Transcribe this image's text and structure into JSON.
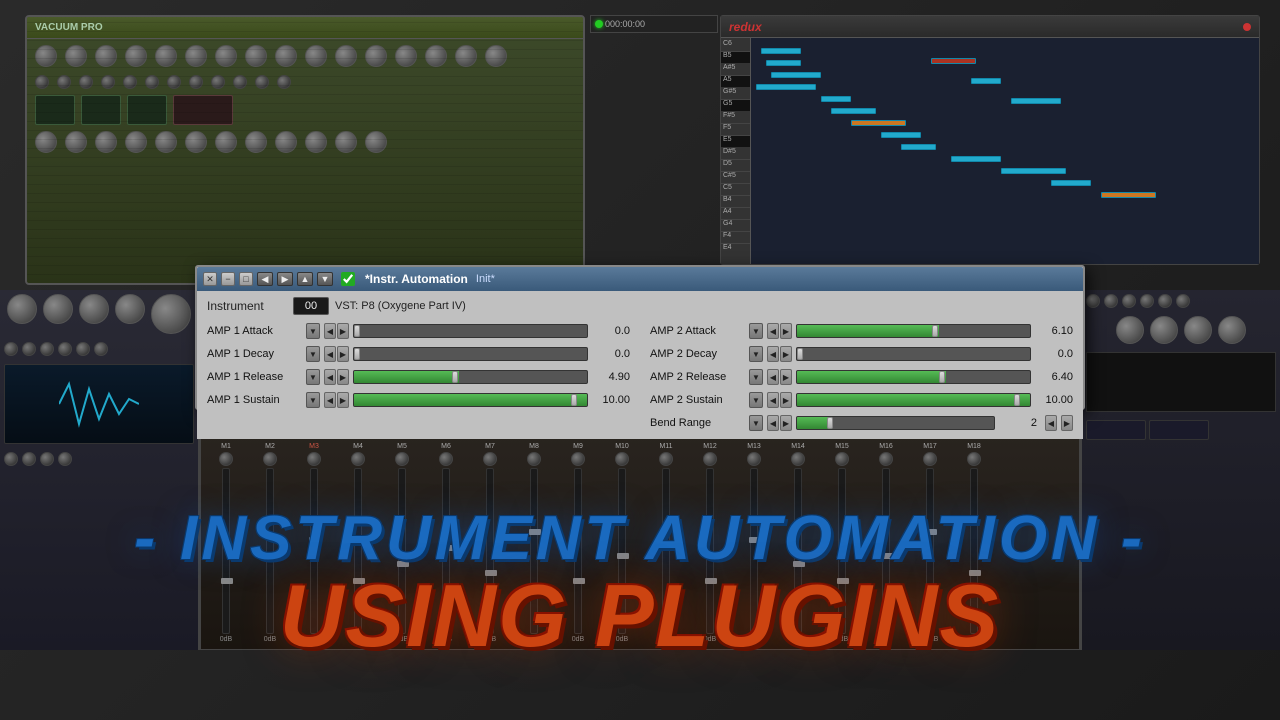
{
  "window": {
    "title": "Instrument Automation",
    "bg_color": "#1a1a1a"
  },
  "dialog": {
    "title": "*Instr. Automation",
    "init_label": "Init*",
    "close_btn": "✕",
    "minimize_btn": "−",
    "restore_btn": "□",
    "instrument": {
      "label": "Instrument",
      "number": "00",
      "vst_info": "VST: P8 (Oxygene Part IV)"
    },
    "params_left": [
      {
        "label": "AMP 1 Attack",
        "value": "0.0",
        "fill_pct": 0
      },
      {
        "label": "AMP 1 Decay",
        "value": "0.0",
        "fill_pct": 0
      },
      {
        "label": "AMP 1 Release",
        "value": "4.90",
        "fill_pct": 45
      },
      {
        "label": "AMP 1 Sustain",
        "value": "10.00",
        "fill_pct": 100
      }
    ],
    "params_right": [
      {
        "label": "AMP 2 Attack",
        "value": "6.10",
        "fill_pct": 61
      },
      {
        "label": "AMP 2 Decay",
        "value": "0.0",
        "fill_pct": 0
      },
      {
        "label": "AMP 2 Release",
        "value": "6.40",
        "fill_pct": 64
      },
      {
        "label": "AMP 2 Sustain",
        "value": "10.00",
        "fill_pct": 100
      },
      {
        "label": "Bend Range",
        "value": "2",
        "fill_pct": 20
      }
    ]
  },
  "overlay": {
    "title": "- Instrument Automation -",
    "subtitle": "Using PluginS"
  },
  "synth": {
    "name": "VACUUM PRO"
  },
  "daw": {
    "logo": "redux"
  },
  "channels": [
    "M1",
    "M2",
    "M3",
    "M4",
    "M5",
    "M6",
    "M7",
    "M8",
    "M9",
    "M10",
    "M11",
    "M12",
    "M13",
    "M14",
    "M15",
    "M16",
    "M17",
    "M18"
  ]
}
